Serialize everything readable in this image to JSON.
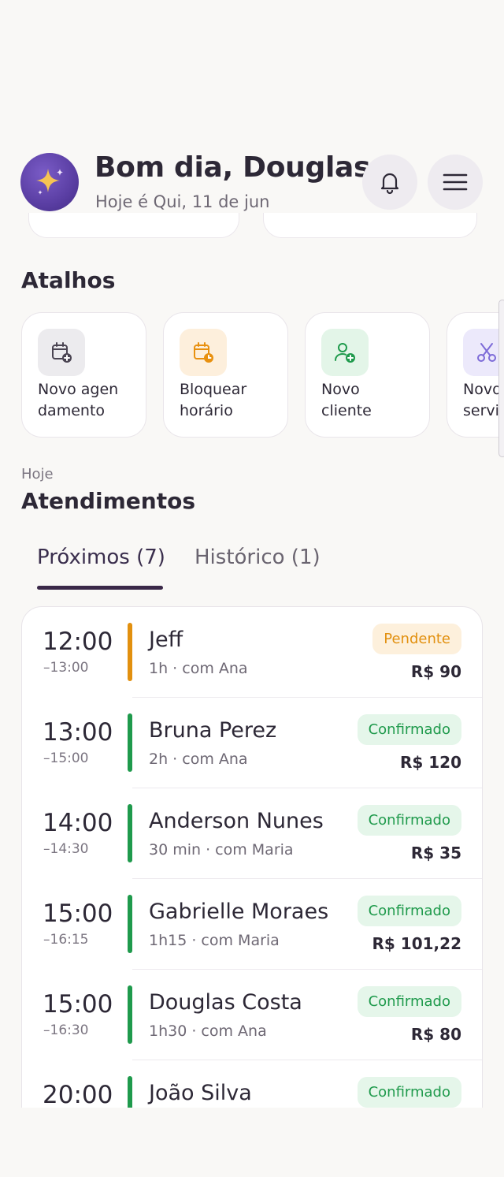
{
  "colors": {
    "background": "#f9f8f6",
    "accent": "#3a2848",
    "pending": "#e2900f",
    "confirmed": "#1f9a4c"
  },
  "header": {
    "avatar_icon": "sparkle-icon",
    "greeting": "Bom dia, Douglas",
    "subtitle": "Hoje é Qui, 11 de jun",
    "notifications_icon": "bell-icon",
    "menu_icon": "hamburger-menu-icon"
  },
  "shortcuts": {
    "title": "Atalhos",
    "items": [
      {
        "label": "Novo agen\ndamento",
        "icon": "calendar-add-icon",
        "tint": "#ecebee",
        "color": "#4a4452"
      },
      {
        "label": "Bloquear\nhorário",
        "icon": "calendar-clock-icon",
        "tint": "#fdefdc",
        "color": "#e8900f"
      },
      {
        "label": "Novo\ncliente",
        "icon": "user-add-icon",
        "tint": "#e3f5e8",
        "color": "#1f9a4c"
      },
      {
        "label": "Novo\nservi",
        "icon": "scissors-icon",
        "tint": "#ece9fb",
        "color": "#7d6bd8"
      }
    ]
  },
  "appointments": {
    "overline": "Hoje",
    "title": "Atendimentos",
    "tabs": [
      {
        "label": "Próximos (7)",
        "active": true
      },
      {
        "label": "Histórico (1)",
        "active": false
      }
    ],
    "items": [
      {
        "time": "12:00",
        "end": "–13:00",
        "client": "Jeff",
        "meta": "1h · com Ana",
        "status": "Pendente",
        "status_type": "pending",
        "price": "R$ 90"
      },
      {
        "time": "13:00",
        "end": "–15:00",
        "client": "Bruna Perez",
        "meta": "2h · com Ana",
        "status": "Confirmado",
        "status_type": "confirmed",
        "price": "R$ 120"
      },
      {
        "time": "14:00",
        "end": "–14:30",
        "client": "Anderson Nunes",
        "meta": "30 min · com Maria",
        "status": "Confirmado",
        "status_type": "confirmed",
        "price": "R$ 35"
      },
      {
        "time": "15:00",
        "end": "–16:15",
        "client": "Gabrielle Moraes",
        "meta": "1h15 · com Maria",
        "status": "Confirmado",
        "status_type": "confirmed",
        "price": "R$ 101,22"
      },
      {
        "time": "15:00",
        "end": "–16:30",
        "client": "Douglas Costa",
        "meta": "1h30 · com Ana",
        "status": "Confirmado",
        "status_type": "confirmed",
        "price": "R$ 80"
      },
      {
        "time": "20:00",
        "end": "",
        "client": "João Silva",
        "meta": "",
        "status": "Confirmado",
        "status_type": "confirmed",
        "price": ""
      }
    ]
  }
}
